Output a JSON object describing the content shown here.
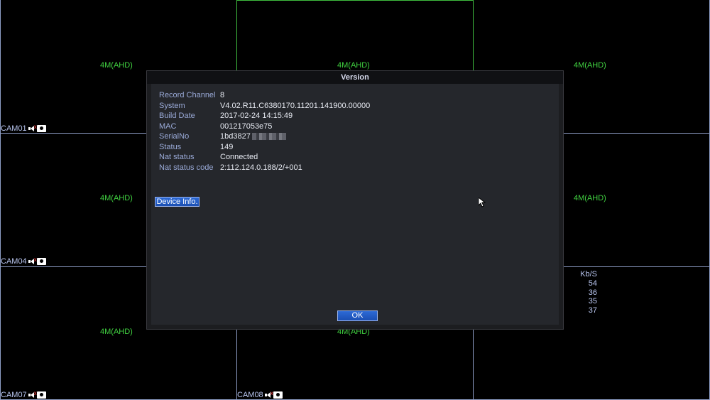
{
  "cells": [
    {
      "res": "4M(AHD)",
      "label": "CAM01"
    },
    {
      "res": "4M(AHD)",
      "label": ""
    },
    {
      "res": "4M(AHD)",
      "label": ""
    },
    {
      "res": "4M(AHD)",
      "label": "CAM04"
    },
    {
      "res": "",
      "label": ""
    },
    {
      "res": "4M(AHD)",
      "label": ""
    },
    {
      "res": "4M(AHD)",
      "label": "CAM07"
    },
    {
      "res": "4M(AHD)",
      "label": "CAM08"
    },
    {
      "res": "",
      "label": ""
    }
  ],
  "bitrate": {
    "header": "Kb/S",
    "values": [
      "54",
      "36",
      "35",
      "37"
    ]
  },
  "dialog": {
    "title": "Version",
    "rows": [
      {
        "key": "Record Channel",
        "value": "8"
      },
      {
        "key": "System",
        "value": "V4.02.R11.C6380170.11201.141900.00000"
      },
      {
        "key": "Build Date",
        "value": "2017-02-24 14:15:49"
      },
      {
        "key": "MAC",
        "value": "001217053e75"
      },
      {
        "key": "SerialNo",
        "value": "1bd3827"
      },
      {
        "key": "Status",
        "value": "149"
      },
      {
        "key": "Nat status",
        "value": "Connected"
      },
      {
        "key": "Nat status code",
        "value": "2:112.124.0.188/2/+001"
      }
    ],
    "device_info_label": "Device Info.",
    "ok_label": "OK"
  }
}
